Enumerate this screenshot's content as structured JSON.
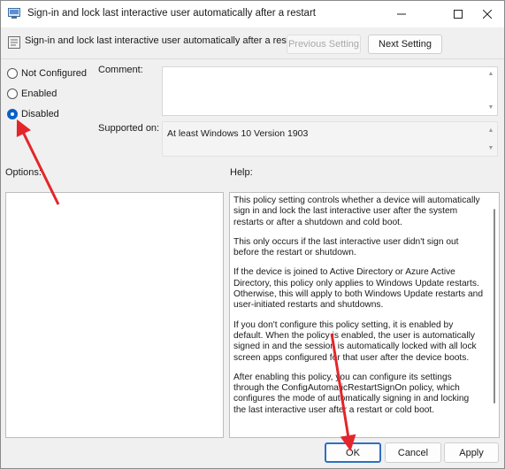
{
  "window": {
    "title": "Sign-in and lock last interactive user automatically after a restart"
  },
  "header": {
    "policy_title": "Sign-in and lock last interactive user automatically after a restart",
    "previous_button": "Previous Setting",
    "next_button": "Next Setting"
  },
  "state": {
    "options": [
      {
        "label": "Not Configured",
        "selected": false
      },
      {
        "label": "Enabled",
        "selected": false
      },
      {
        "label": "Disabled",
        "selected": true
      }
    ]
  },
  "comment": {
    "label": "Comment:",
    "value": ""
  },
  "supported": {
    "label": "Supported on:",
    "value": "At least Windows 10 Version 1903"
  },
  "options_panel": {
    "label": "Options:"
  },
  "help_panel": {
    "label": "Help:",
    "paragraphs": [
      "This policy setting controls whether a device will automatically sign in and lock the last interactive user after the system restarts or after a shutdown and cold boot.",
      "This only occurs if the last interactive user didn't sign out before the restart or shutdown.",
      "If the device is joined to Active Directory or Azure Active Directory, this policy only applies to Windows Update restarts. Otherwise, this will apply to both Windows Update restarts and user-initiated restarts and shutdowns.",
      "If you don't configure this policy setting, it is enabled by default. When the policy is enabled, the user is automatically signed in and the session is automatically locked with all lock screen apps configured for that user after the device boots.",
      "After enabling this policy, you can configure its settings through the ConfigAutomaticRestartSignOn policy, which configures the mode of automatically signing in and locking the last interactive user after a restart or cold boot."
    ]
  },
  "footer": {
    "ok": "OK",
    "cancel": "Cancel",
    "apply": "Apply"
  },
  "annotations": {
    "arrow_color": "#e3262b"
  }
}
